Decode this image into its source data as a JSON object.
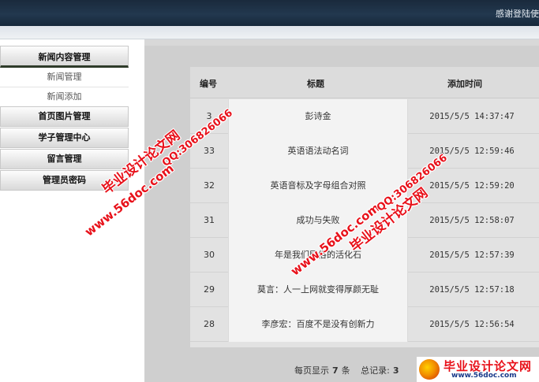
{
  "header": {
    "welcome_text": "感谢登陆使"
  },
  "sidebar": {
    "news_section": {
      "label": "新闻内容管理",
      "items": [
        {
          "label": "新闻管理"
        },
        {
          "label": "新闻添加"
        }
      ]
    },
    "sections": [
      {
        "label": "首页图片管理"
      },
      {
        "label": "学子管理中心"
      },
      {
        "label": "留言管理"
      },
      {
        "label": "管理员密码"
      }
    ]
  },
  "table": {
    "columns": [
      "编号",
      "标题",
      "添加时间"
    ],
    "rows": [
      {
        "id": "3",
        "title": "彭诗金",
        "time": "2015/5/5 14:37:47"
      },
      {
        "id": "33",
        "title": "英语语法动名词",
        "time": "2015/5/5 12:59:46"
      },
      {
        "id": "32",
        "title": "英语音标及字母组合对照",
        "time": "2015/5/5 12:59:20"
      },
      {
        "id": "31",
        "title": "成功与失败",
        "time": "2015/5/5 12:58:07"
      },
      {
        "id": "30",
        "title": "年是我们民俗的活化石",
        "time": "2015/5/5 12:57:39"
      },
      {
        "id": "29",
        "title": "莫言：人一上网就变得厚颜无耻",
        "time": "2015/5/5 12:57:18"
      },
      {
        "id": "28",
        "title": "李彦宏：百度不是没有创新力",
        "time": "2015/5/5 12:56:54"
      }
    ]
  },
  "pager": {
    "per_page_label": "每页显示",
    "per_page_value": "7",
    "unit": "条",
    "total_label": "总记录:",
    "total_value": "3"
  },
  "watermark": {
    "brand": "毕业设计论文网",
    "qq": "QQ:306826066",
    "url": "www.56doc.com",
    "logo_text": "毕业设计论文网",
    "logo_url": "www.56doc.com"
  }
}
